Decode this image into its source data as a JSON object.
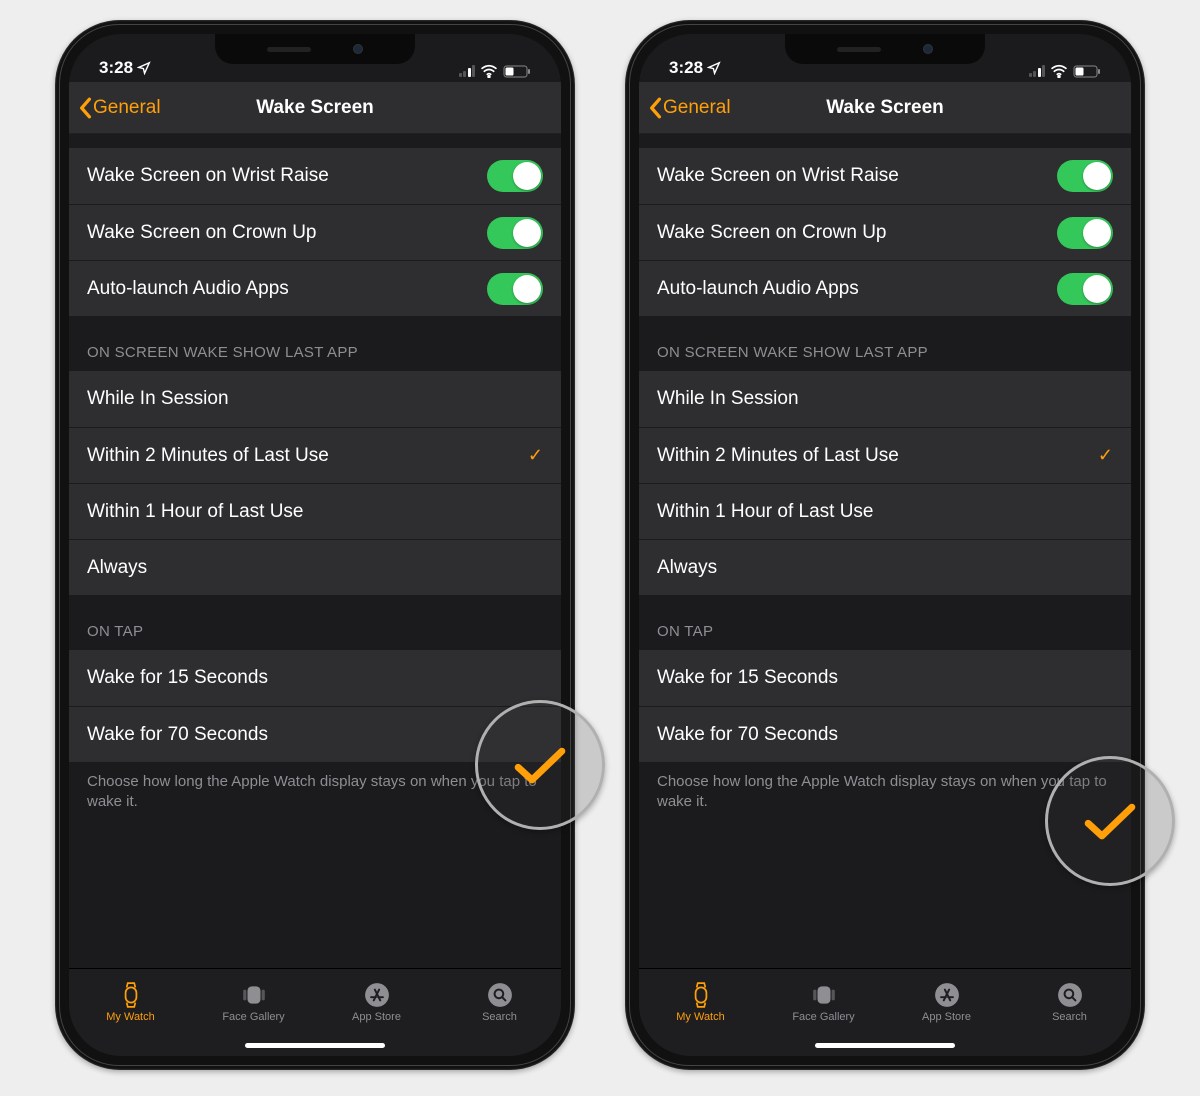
{
  "status": {
    "time": "3:28"
  },
  "nav": {
    "back": "General",
    "title": "Wake Screen"
  },
  "toggles": [
    {
      "label": "Wake Screen on Wrist Raise",
      "on": true
    },
    {
      "label": "Wake Screen on Crown Up",
      "on": true
    },
    {
      "label": "Auto-launch Audio Apps",
      "on": true
    }
  ],
  "section_last_app": {
    "header": "ON SCREEN WAKE SHOW LAST APP",
    "options": [
      "While In Session",
      "Within 2 Minutes of Last Use",
      "Within 1 Hour of Last Use",
      "Always"
    ],
    "selected": 1
  },
  "section_tap": {
    "header": "ON TAP",
    "options": [
      "Wake for 15 Seconds",
      "Wake for 70 Seconds"
    ],
    "footer": "Choose how long the Apple Watch display stays on when you tap to wake it."
  },
  "tabs": [
    "My Watch",
    "Face Gallery",
    "App Store",
    "Search"
  ],
  "phones": [
    {
      "tap_selected": 0
    },
    {
      "tap_selected": 1
    }
  ]
}
